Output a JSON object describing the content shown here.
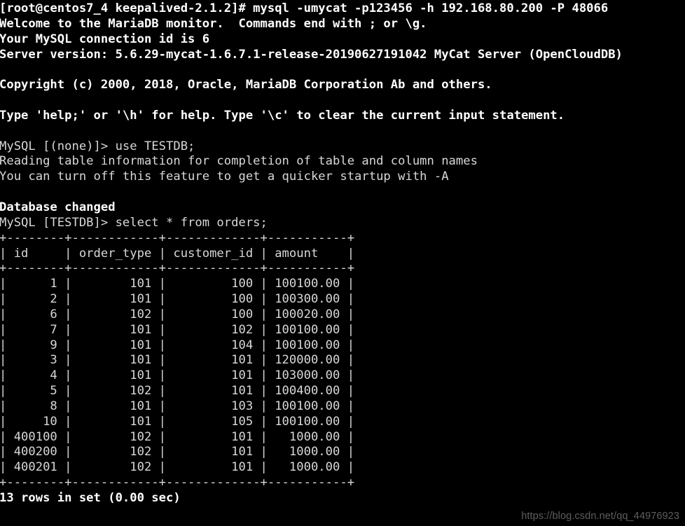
{
  "terminal": {
    "prompt_host": "[root@centos7_4 keepalived-2.1.2]#",
    "command": "mysql -umycat -p123456 -h 192.168.80.200 -P 48066",
    "lines": [
      {
        "text": "[root@centos7_4 keepalived-2.1.2]# mysql -umycat -p123456 -h 192.168.80.200 -P 48066",
        "bold": true
      },
      {
        "text": "Welcome to the MariaDB monitor.  Commands end with ; or \\g.",
        "bold": true
      },
      {
        "text": "Your MySQL connection id is 6",
        "bold": true
      },
      {
        "text": "Server version: 5.6.29-mycat-1.6.7.1-release-20190627191042 MyCat Server (OpenCloudDB)",
        "bold": true
      },
      {
        "text": " ",
        "bold": false
      },
      {
        "text": "Copyright (c) 2000, 2018, Oracle, MariaDB Corporation Ab and others.",
        "bold": true
      },
      {
        "text": " ",
        "bold": false
      },
      {
        "text": "Type 'help;' or '\\h' for help. Type '\\c' to clear the current input statement.",
        "bold": true
      },
      {
        "text": " ",
        "bold": false
      },
      {
        "text": "MySQL [(none)]> use TESTDB;",
        "bold": false
      },
      {
        "text": "Reading table information for completion of table and column names",
        "bold": false
      },
      {
        "text": "You can turn off this feature to get a quicker startup with -A",
        "bold": false
      },
      {
        "text": " ",
        "bold": false
      },
      {
        "text": "Database changed",
        "bold": true
      },
      {
        "text": "MySQL [TESTDB]> select * from orders;",
        "bold": false
      },
      {
        "text": "+--------+------------+-------------+-----------+",
        "bold": false
      },
      {
        "text": "| id     | order_type | customer_id | amount    |",
        "bold": false
      },
      {
        "text": "+--------+------------+-------------+-----------+",
        "bold": false
      },
      {
        "text": "|      1 |        101 |         100 | 100100.00 |",
        "bold": false
      },
      {
        "text": "|      2 |        101 |         100 | 100300.00 |",
        "bold": false
      },
      {
        "text": "|      6 |        102 |         100 | 100020.00 |",
        "bold": false
      },
      {
        "text": "|      7 |        101 |         102 | 100100.00 |",
        "bold": false
      },
      {
        "text": "|      9 |        101 |         104 | 100100.00 |",
        "bold": false
      },
      {
        "text": "|      3 |        101 |         101 | 120000.00 |",
        "bold": false
      },
      {
        "text": "|      4 |        101 |         101 | 103000.00 |",
        "bold": false
      },
      {
        "text": "|      5 |        102 |         101 | 100400.00 |",
        "bold": false
      },
      {
        "text": "|      8 |        101 |         103 | 100100.00 |",
        "bold": false
      },
      {
        "text": "|     10 |        101 |         105 | 100100.00 |",
        "bold": false
      },
      {
        "text": "| 400100 |        102 |         101 |   1000.00 |",
        "bold": false
      },
      {
        "text": "| 400200 |        102 |         101 |   1000.00 |",
        "bold": false
      },
      {
        "text": "| 400201 |        102 |         101 |   1000.00 |",
        "bold": false
      },
      {
        "text": "+--------+------------+-------------+-----------+",
        "bold": false
      },
      {
        "text": "13 rows in set (0.00 sec)",
        "bold": true
      }
    ],
    "query_result": {
      "sql": "select * from orders;",
      "columns": [
        "id",
        "order_type",
        "customer_id",
        "amount"
      ],
      "rows": [
        [
          "1",
          "101",
          "100",
          "100100.00"
        ],
        [
          "2",
          "101",
          "100",
          "100300.00"
        ],
        [
          "6",
          "102",
          "100",
          "100020.00"
        ],
        [
          "7",
          "101",
          "102",
          "100100.00"
        ],
        [
          "9",
          "101",
          "104",
          "100100.00"
        ],
        [
          "3",
          "101",
          "101",
          "120000.00"
        ],
        [
          "4",
          "101",
          "101",
          "103000.00"
        ],
        [
          "5",
          "102",
          "101",
          "100400.00"
        ],
        [
          "8",
          "101",
          "103",
          "100100.00"
        ],
        [
          "10",
          "101",
          "105",
          "100100.00"
        ],
        [
          "400100",
          "102",
          "101",
          "1000.00"
        ],
        [
          "400200",
          "102",
          "101",
          "1000.00"
        ],
        [
          "400201",
          "102",
          "101",
          "1000.00"
        ]
      ],
      "row_count_text": "13 rows in set (0.00 sec)"
    },
    "database": "TESTDB",
    "connection_id": "6",
    "server_version": "5.6.29-mycat-1.6.7.1-release-20190627191042 MyCat Server (OpenCloudDB)"
  },
  "watermark": {
    "text": "https://blog.csdn.net/qq_44976923"
  }
}
